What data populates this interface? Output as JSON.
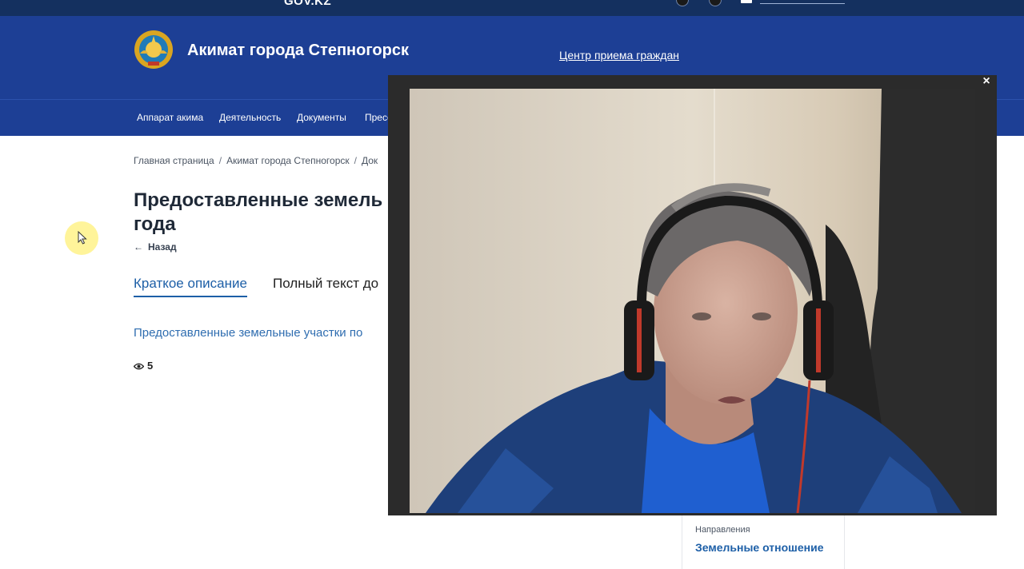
{
  "topbar": {
    "domain": "GOV.KZ"
  },
  "header": {
    "title": "Акимат города Степногорск",
    "reception": "Центр приема граждан"
  },
  "nav": {
    "items": [
      "Аппарат акима",
      "Деятельность",
      "Документы",
      "Пресс"
    ]
  },
  "breadcrumb": {
    "items": [
      "Главная страница",
      "Акимат города Степногорск",
      "Док"
    ]
  },
  "page": {
    "title": "Предоставленные земель года",
    "title_line1": "Предоставленные земель",
    "title_line2": "года",
    "back": "Назад",
    "tabs": [
      "Краткое описание",
      "Полный текст до"
    ],
    "description_link": "Предоставленные земельные участки по",
    "views": "5"
  },
  "sidebar": {
    "label": "Направления",
    "value": "Земельные отношение"
  },
  "video": {
    "close": "×"
  },
  "colors": {
    "header": "#1d3f95",
    "topbar": "#14305f",
    "accent": "#1d5fa7",
    "link": "#2f6db0"
  }
}
